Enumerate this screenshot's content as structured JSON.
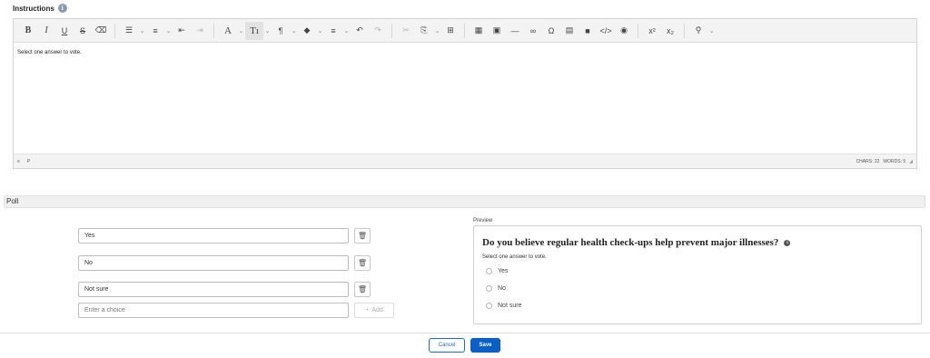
{
  "instructions": {
    "label": "Instructions",
    "info_glyph": "i"
  },
  "toolbar": {
    "bold": "B",
    "italic": "I",
    "underline": "U",
    "strike": "S",
    "eraser": "⌫",
    "bullets": "☰",
    "numbered": "≡",
    "outdent": "⇤",
    "indent": "⇥",
    "font_color": "A",
    "font_size": "Tı",
    "paragraph": "¶",
    "highlight": "◆",
    "align": "≡",
    "undo": "↶",
    "redo": "↷",
    "cut": "✂",
    "paste": "⎘",
    "select_all": "⊞",
    "table": "▦",
    "image": "▣",
    "hr": "—",
    "link": "∞",
    "omega": "Ω",
    "file": "▤",
    "video": "■",
    "code": "</>",
    "preview": "◉",
    "superscript": "x²",
    "subscript": "x₂",
    "find": "⚲",
    "chevron": "⌄"
  },
  "editor": {
    "content": "Select one answer to vote.",
    "status_path": "P",
    "status_menu": "≡",
    "chars": "CHARS: 22",
    "words": "WORDS: 5"
  },
  "poll": {
    "section_title": "Poll",
    "choices": [
      "Yes",
      "No",
      "Not sure"
    ],
    "new_choice_placeholder": "Enter a choice",
    "add_label": "Add",
    "add_glyph": "+",
    "trash_glyph": "🗑"
  },
  "preview": {
    "label": "Preview",
    "question": "Do you believe regular health check-ups help prevent major illnesses?",
    "info_glyph": "i",
    "instructions": "Select one answer to vote.",
    "options": [
      "Yes",
      "No",
      "Not sure"
    ]
  },
  "footer": {
    "cancel": "Cancel",
    "save": "Save"
  },
  "colors": {
    "primary": "#0a60c8",
    "border": "#d4d4d4",
    "toolbar_bg": "#f3f3f3"
  }
}
